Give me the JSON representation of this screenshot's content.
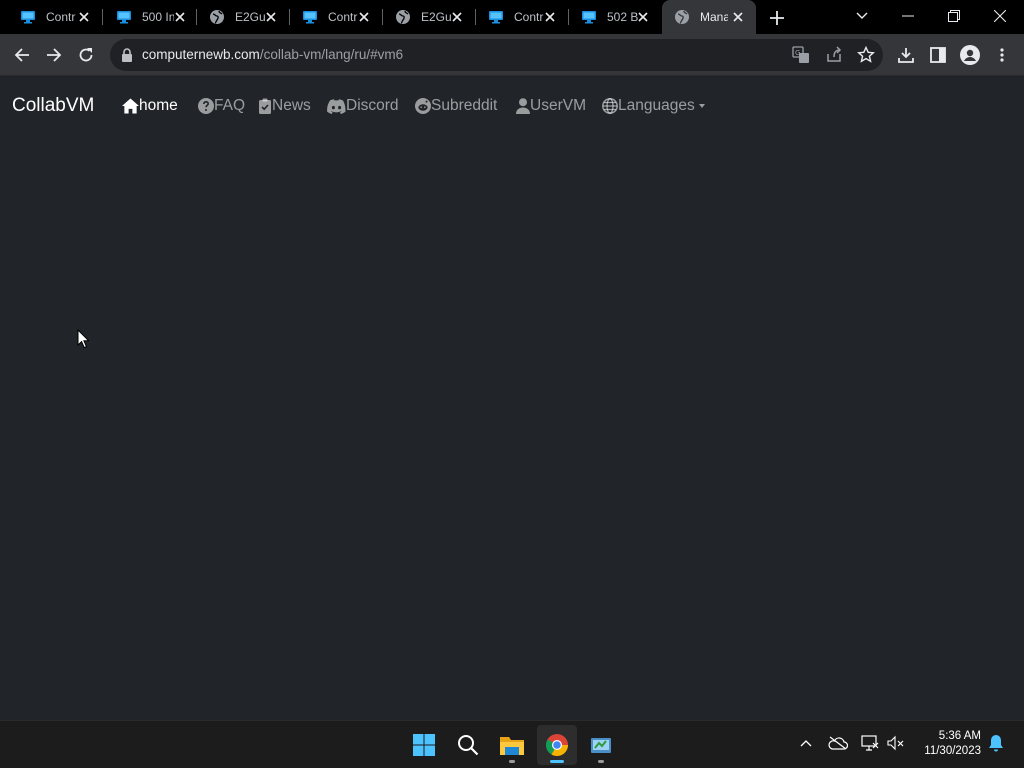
{
  "browser": {
    "tabs": [
      {
        "title": "Contr",
        "favicon": "monitor-icon",
        "active": false
      },
      {
        "title": "500 In",
        "favicon": "monitor-icon",
        "active": false
      },
      {
        "title": "E2Gu",
        "favicon": "globe-icon",
        "active": false
      },
      {
        "title": "Contr",
        "favicon": "monitor-icon",
        "active": false
      },
      {
        "title": "E2Gu",
        "favicon": "globe-icon",
        "active": false
      },
      {
        "title": "Contr",
        "favicon": "monitor-icon",
        "active": false
      },
      {
        "title": "502 B",
        "favicon": "monitor-icon",
        "active": false
      },
      {
        "title": "Mana",
        "favicon": "globe-icon",
        "active": true
      }
    ],
    "address": {
      "host": "computernewb.com",
      "path": "/collab-vm/lang/ru/#vm6"
    }
  },
  "site": {
    "brand": "CollabVM",
    "nav": [
      {
        "label": "home",
        "icon": "home-icon",
        "active": true
      },
      {
        "label": "FAQ",
        "icon": "question-circle-icon",
        "active": false
      },
      {
        "label": "News",
        "icon": "clipboard-check-icon",
        "active": false
      },
      {
        "label": "Discord",
        "icon": "discord-icon",
        "active": false
      },
      {
        "label": "Subreddit",
        "icon": "reddit-icon",
        "active": false
      },
      {
        "label": "UserVM",
        "icon": "user-icon",
        "active": false
      },
      {
        "label": "Languages",
        "icon": "globe-icon",
        "active": false,
        "dropdown": true
      }
    ]
  },
  "taskbar": {
    "apps": [
      "start-icon",
      "search-icon",
      "file-explorer-icon",
      "chrome-icon",
      "app-icon"
    ],
    "time": "5:36 AM",
    "date": "11/30/2023"
  },
  "colors": {
    "page_background": "#212529",
    "browser_frame": "#000000",
    "toolbar": "#35363a",
    "accent": "#4cc2ff"
  }
}
